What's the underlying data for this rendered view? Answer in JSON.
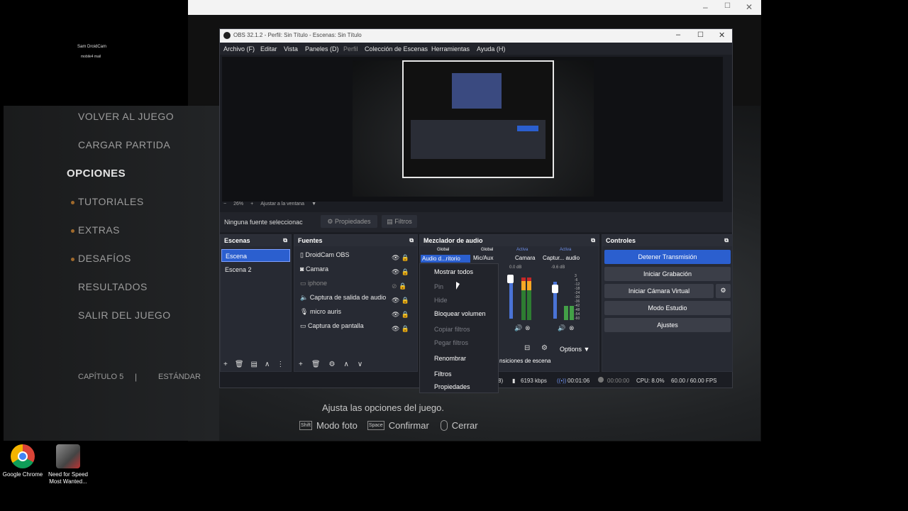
{
  "desktop": {
    "icons": [
      {
        "label": "Google Chrome"
      },
      {
        "label": "Need for Speed Most Wanted..."
      }
    ]
  },
  "game": {
    "logo_line1": "Sam DroidCam",
    "logo_line2": "mobile4 mail",
    "menu": [
      "VOLVER AL JUEGO",
      "CARGAR PARTIDA",
      "OPCIONES",
      "TUTORIALES",
      "EXTRAS",
      "DESAFÍOS",
      "RESULTADOS",
      "SALIR DEL JUEGO"
    ],
    "chapter": "CAPÍTULO 5",
    "separator": "|",
    "difficulty": "ESTÁNDAR",
    "hint": "Ajusta las opciones del juego.",
    "actions": [
      {
        "key": "Shift",
        "label": "Modo foto"
      },
      {
        "key": "Space",
        "label": "Confirmar"
      },
      {
        "key": "",
        "label": "Cerrar"
      }
    ]
  },
  "obs": {
    "title": "OBS 32.1.2 - Perfil: Sin Título - Escenas: Sin Título",
    "menu": [
      "Archivo (F)",
      "Editar",
      "Vista",
      "Paneles (D)",
      "Perfil",
      "Colección de Escenas",
      "Herramientas",
      "Ayuda (H)"
    ],
    "zoom": {
      "pct": "26%",
      "fit": "Ajustar a la ventana"
    },
    "source_bar": {
      "status": "Ninguna fuente seleccionac",
      "properties": "Propiedades",
      "filters": "Filtros"
    },
    "scenes": {
      "title": "Escenas",
      "items": [
        "Escena",
        "Escena 2"
      ]
    },
    "sources": {
      "title": "Fuentes",
      "items": [
        "DroidCam OBS",
        "Camara",
        "iphone",
        "Captura de salida de audio",
        "micro auris",
        "Captura de pantalla"
      ]
    },
    "mixer": {
      "title": "Mezclador de audio",
      "tracks": [
        {
          "scope": "Global",
          "name": "Audio d...ritorio"
        },
        {
          "scope": "Global",
          "name": "Mic/Aux"
        },
        {
          "scope": "Activa",
          "name": "Camara",
          "db": "0.0 dB"
        },
        {
          "scope": "Activa",
          "name": "Captur... audio",
          "db": "-9.6 dB"
        }
      ],
      "scale": [
        "3",
        "-6",
        "-12",
        "-18",
        "-24",
        "-30",
        "-36",
        "-42",
        "-48",
        "-54",
        "-60"
      ],
      "options": "Options",
      "transitions": "nsiciones de escena"
    },
    "controls": {
      "title": "Controles",
      "buttons": [
        "Detener Transmisión",
        "Iniciar Grabación",
        "Iniciar Cámara Virtual",
        "Modo Estudio",
        "Ajustes"
      ]
    },
    "context_menu": [
      "Mostrar todos",
      "Pin",
      "Hide",
      "Bloquear volumen",
      "Copiar filtros",
      "Pegar filtros",
      "Renombrar",
      "Filtros",
      "Propiedades"
    ],
    "status": {
      "bitrate": "6193 kbps",
      "stream_time": "00:01:06",
      "rec_time": "00:00:00",
      "cpu": "CPU: 8.0%",
      "fps": "60.00 / 60.00 FPS",
      "paren": "8)"
    }
  }
}
